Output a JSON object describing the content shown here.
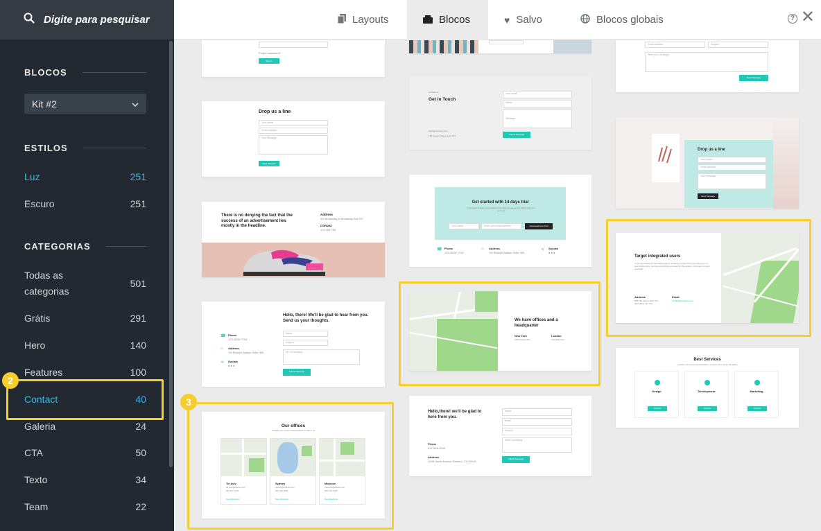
{
  "search": {
    "placeholder": "Digite para pesquisar"
  },
  "sidebar": {
    "blocos_title": "BLOCOS",
    "kit_value": "Kit #2",
    "estilos_title": "ESTILOS",
    "estilos": [
      {
        "label": "Luz",
        "count": "251"
      },
      {
        "label": "Escuro",
        "count": "251"
      }
    ],
    "categorias_title": "CATEGORIAS",
    "categorias": [
      {
        "label": "Todas as categorias",
        "count": "501"
      },
      {
        "label": "Grátis",
        "count": "291"
      },
      {
        "label": "Hero",
        "count": "140"
      },
      {
        "label": "Features",
        "count": "100"
      },
      {
        "label": "Contact",
        "count": "40"
      },
      {
        "label": "Galeria",
        "count": "24"
      },
      {
        "label": "CTA",
        "count": "50"
      },
      {
        "label": "Texto",
        "count": "34"
      },
      {
        "label": "Team",
        "count": "22"
      }
    ]
  },
  "tabs": [
    {
      "label": "Layouts"
    },
    {
      "label": "Blocos"
    },
    {
      "label": "Salvo"
    },
    {
      "label": "Blocos globais"
    }
  ],
  "badges": {
    "two": "2",
    "three": "3"
  },
  "colors": {
    "accent": "#3fb6e6",
    "highlight": "#f5cd2c",
    "teal": "#20c8b5"
  },
  "cards": {
    "c1": {
      "forgot": "Forgot password?",
      "btn": "Sign in"
    },
    "c2": {
      "title": "Drop us a line",
      "f1": "Your name",
      "f2": "Email Address",
      "f3": "Your Message",
      "btn": "Send Message"
    },
    "c3": {
      "headline": "There is no denying the fact that the success of an advertisement lies mostly in the headline.",
      "addr_label": "Address",
      "addr": "3/9 Broadway & Broadway Ave NY",
      "contact_label": "Contact",
      "contact": "123 456 789"
    },
    "c4": {
      "title": "Hello, there! We'll be glad to hear from you. Send us your thoughts.",
      "phone_label": "Phone",
      "phone": "123-4526-7724",
      "addr_label": "Address",
      "addr": "7/8 Russell Station Suite 305",
      "socials_label": "Socials",
      "f1": "Name",
      "f2": "Subject",
      "f3": "Hi! I'm reaching...",
      "btn": "Submit Message"
    },
    "c5": {
      "title": "Our offices",
      "sub": "Contact one of our representatives to talk to us",
      "offices": [
        {
          "city": "Tel Aviv",
          "email": "tel.aviv@offices.com",
          "phone": "555 767 1234",
          "link": "See directions"
        },
        {
          "city": "Sydney",
          "email": "sydney@offices.com",
          "phone": "555 443 4836",
          "link": "See directions"
        },
        {
          "city": "Moscow",
          "email": "moscow@offices.com",
          "phone": "555 373 4125",
          "link": "See directions"
        }
      ]
    },
    "m2": {
      "kicker": "Contact us",
      "title": "Get in Touch",
      "email": "hello@company.com",
      "addr": "239 Newton Hayes Suite 304",
      "f1": "Your email",
      "f2": "Name",
      "f3": "Message",
      "btn": "Submit Message"
    },
    "m3": {
      "title": "Get started with 14 days trial",
      "sub": "If you want to learn your product more why not start a free trial to help you succeed",
      "f1": "Your Name",
      "f2": "Enter your email address",
      "btn": "Download Free Trial",
      "phone_label": "Phone",
      "phone": "123-4526-7724",
      "addr_label": "Address",
      "addr": "7/8 Russell Station Suite 305",
      "socials_label": "Socials"
    },
    "m4": {
      "title": "We have offices and a headquarter",
      "ny_label": "New York",
      "ny": "7816 Clinton Pwr",
      "london_label": "London",
      "london": "100 Brick Ave"
    },
    "m5": {
      "title": "Hello,there! we'll be glad to here from you.",
      "phone_label": "Phone",
      "phone": "612-599-3345",
      "addr_label": "Address",
      "addr": "1208 Uncle Avenue Remato, CA 90019",
      "f1": "Name",
      "f2": "Email",
      "f3": "Subject",
      "f4": "Write something...",
      "btn": "Submit Message"
    },
    "r1": {
      "f1": "Email address",
      "f2": "Subject",
      "f3": "Write your message",
      "btn": "Send Message"
    },
    "r2": {
      "title": "Drop us a line",
      "f1": "Your Name",
      "f2": "Email Address",
      "f3": "Your Message",
      "btn": "Send Message"
    },
    "r3": {
      "title": "Target integrated users",
      "text": "If you are looking for the easiest way to implement your forms into a layout or to your online store, we have everything you need for the solution. Just send us your message.",
      "addr_label": "Address",
      "addr": "508 Pine Street Suite 570 Manhattan, NY City",
      "email_label": "Email",
      "email": "contact@company.com"
    },
    "r4": {
      "title": "Best Services",
      "sub": "Contact one of our representatives to know more about our plans",
      "services": [
        {
          "name": "Design",
          "btn": "Contact"
        },
        {
          "name": "Development",
          "btn": "Contact"
        },
        {
          "name": "Marketing",
          "btn": "Contact"
        }
      ]
    }
  }
}
